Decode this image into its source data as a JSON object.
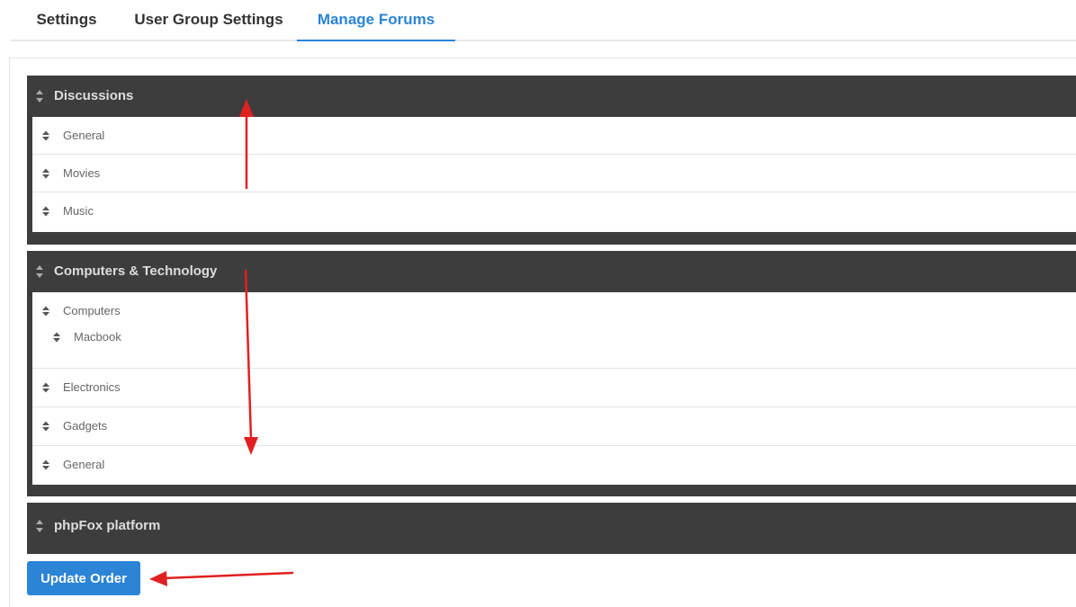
{
  "tabs": [
    {
      "label": "Settings",
      "active": false
    },
    {
      "label": "User Group Settings",
      "active": false
    },
    {
      "label": "Manage Forums",
      "active": true
    }
  ],
  "categories": [
    {
      "title": "Discussions",
      "forums": [
        {
          "label": "General"
        },
        {
          "label": "Movies"
        },
        {
          "label": "Music"
        }
      ]
    },
    {
      "title": "Computers & Technology",
      "forums": [
        {
          "label": "Computers",
          "children": [
            {
              "label": "Macbook"
            }
          ]
        },
        {
          "label": "Electronics"
        },
        {
          "label": "Gadgets"
        },
        {
          "label": "General"
        }
      ]
    },
    {
      "title": "phpFox platform",
      "forums": []
    }
  ],
  "buttons": {
    "update_order": "Update Order"
  },
  "icons": {
    "drag_handle": "sort-icon",
    "annotation": "red-arrow"
  },
  "colors": {
    "accent": "#2b84d6",
    "category_bg": "#3d3d3d",
    "annotation": "#e02020"
  }
}
